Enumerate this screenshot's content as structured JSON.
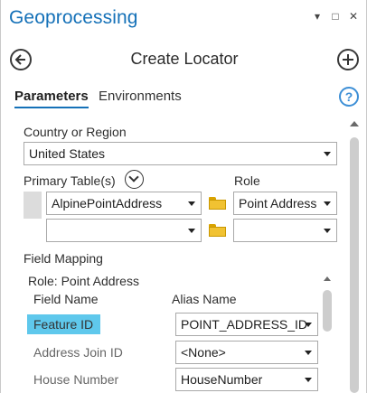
{
  "window": {
    "title": "Geoprocessing",
    "controls": {
      "menu": "▾",
      "maximize": "□",
      "close": "✕"
    }
  },
  "tool": {
    "title": "Create Locator",
    "back_icon": "arrow-left-circle-icon",
    "add_icon": "plus-circle-icon"
  },
  "tabs": [
    {
      "label": "Parameters",
      "active": true
    },
    {
      "label": "Environments",
      "active": false
    }
  ],
  "help": {
    "glyph": "?"
  },
  "country": {
    "label": "Country or Region",
    "value": "United States"
  },
  "primary_tables": {
    "label": "Primary Table(s)",
    "role_label": "Role",
    "rows": [
      {
        "table": "AlpinePointAddress",
        "role": "Point Address"
      },
      {
        "table": "",
        "role": ""
      }
    ]
  },
  "field_mapping": {
    "label": "Field Mapping",
    "role_caption": "Role: Point Address",
    "col_field": "Field Name",
    "col_alias": "Alias Name",
    "rows": [
      {
        "field": "Feature ID",
        "alias": "POINT_ADDRESS_ID",
        "selected": true
      },
      {
        "field": "Address Join ID",
        "alias": "<None>",
        "selected": false
      },
      {
        "field": "House Number",
        "alias": "HouseNumber",
        "selected": false
      }
    ]
  },
  "colors": {
    "accent": "#1571b8",
    "selection": "#5fc8ec",
    "folder": "#f1c232"
  }
}
